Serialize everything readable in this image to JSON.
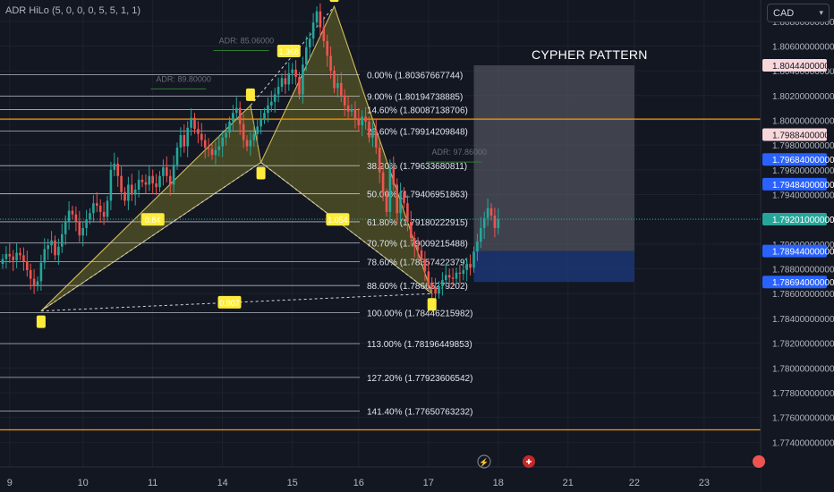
{
  "indicator": "ADR HiLo (5, 0, 0, 0, 5, 5, 1, 1)",
  "currency": "CAD",
  "pattern_title": "CYPHER PATTERN",
  "colors": {
    "background": "#131722",
    "grid": "#1e222d",
    "up": "#26a69a",
    "down": "#ef5350",
    "harmonic_fill": "#6b6b26",
    "harmonic_line": "#c8b45a",
    "fib_line": "#d1d4dc",
    "orange_line": "#ff9800",
    "price_highlight": "#2962ff",
    "price_current": "#26a69a",
    "target_box": "#5d5f6a",
    "stop_box": "#1c3470"
  },
  "chart_data": {
    "type": "candlestick",
    "x_ticks": [
      {
        "label": "9",
        "bar": 2
      },
      {
        "label": "10",
        "bar": 23
      },
      {
        "label": "11",
        "bar": 43
      },
      {
        "label": "14",
        "bar": 63
      },
      {
        "label": "15",
        "bar": 83
      },
      {
        "label": "16",
        "bar": 102
      },
      {
        "label": "17",
        "bar": 122
      },
      {
        "label": "18",
        "bar": 142
      },
      {
        "label": "21",
        "bar": 162
      },
      {
        "label": "22",
        "bar": 181
      },
      {
        "label": "23",
        "bar": 201
      }
    ],
    "y_range": [
      1.772,
      1.8095
    ],
    "y_ticks": [
      "1.80800000000",
      "1.80600000000",
      "1.80400000000",
      "1.80200000000",
      "1.80000000000",
      "1.79800000000",
      "1.79600000000",
      "1.79400000000",
      "1.79200000000",
      "1.79000000000",
      "1.78800000000",
      "1.78600000000",
      "1.78400000000",
      "1.78200000000",
      "1.78000000000",
      "1.77800000000",
      "1.77600000000",
      "1.77400000000"
    ],
    "price_labels": [
      {
        "text": "1.80444000000",
        "value": 1.80444,
        "style": "pink"
      },
      {
        "text": "1.79884000000",
        "value": 1.79884,
        "style": "pink"
      },
      {
        "text": "1.79684000000",
        "value": 1.79684,
        "style": "blue"
      },
      {
        "text": "1.79484000000",
        "value": 1.79484,
        "style": "blue"
      },
      {
        "text": "1.79201000000",
        "value": 1.79201,
        "style": "green"
      },
      {
        "text": "1.78944000000",
        "value": 1.78944,
        "style": "blue"
      },
      {
        "text": "1.78694000000",
        "value": 1.78694,
        "style": "blue"
      }
    ],
    "close_series": [
      1.7888,
      1.7892,
      1.789,
      1.7887,
      1.7893,
      1.7891,
      1.7886,
      1.7879,
      1.7872,
      1.7866,
      1.787,
      1.7885,
      1.7896,
      1.7899,
      1.7903,
      1.7891,
      1.7898,
      1.7908,
      1.7918,
      1.7927,
      1.7924,
      1.7918,
      1.7907,
      1.7913,
      1.792,
      1.7925,
      1.7933,
      1.7931,
      1.7926,
      1.7922,
      1.7935,
      1.796,
      1.7965,
      1.7955,
      1.7942,
      1.7935,
      1.7948,
      1.794,
      1.7944,
      1.7952,
      1.795,
      1.7948,
      1.7955,
      1.7949,
      1.7946,
      1.7955,
      1.7962,
      1.7955,
      1.7948,
      1.7964,
      1.7978,
      1.7988,
      1.7979,
      1.7994,
      1.8002,
      1.7993,
      1.7989,
      1.7984,
      1.7978,
      1.7977,
      1.7972,
      1.7976,
      1.7979,
      1.7986,
      1.799,
      1.7999,
      1.8006,
      1.801,
      1.7997,
      1.7984,
      1.7979,
      1.7984,
      1.7989,
      1.7995,
      1.8001,
      1.8006,
      1.8012,
      1.8015,
      1.8021,
      1.8027,
      1.8034,
      1.8029,
      1.8038,
      1.8041,
      1.8035,
      1.8021,
      1.8045,
      1.8059,
      1.8066,
      1.8079,
      1.8088,
      1.8075,
      1.8064,
      1.8052,
      1.804,
      1.8026,
      1.803,
      1.802,
      1.8012,
      1.8007,
      1.8009,
      1.8001,
      1.7996,
      1.8003,
      1.7999,
      1.7986,
      1.7992,
      1.7978,
      1.7958,
      1.7941,
      1.7926,
      1.7962,
      1.7948,
      1.7925,
      1.7942,
      1.7933,
      1.7918,
      1.7905,
      1.7898,
      1.7895,
      1.7888,
      1.7878,
      1.7868,
      1.7865,
      1.786,
      1.7866,
      1.7871,
      1.7875,
      1.7873,
      1.7872,
      1.7877,
      1.7876,
      1.7879,
      1.7884,
      1.7881,
      1.7894,
      1.7902,
      1.7913,
      1.7921,
      1.7929,
      1.7923,
      1.7913,
      1.792
    ],
    "fib_levels": [
      {
        "label": "0.00% (1.80367667744)",
        "value": 1.80367667744
      },
      {
        "label": "9.00% (1.80194738885)",
        "value": 1.80194738885
      },
      {
        "label": "14.60% (1.80087138706)",
        "value": 1.80087138706
      },
      {
        "label": "23.60% (1.79914209848)",
        "value": 1.79914209848
      },
      {
        "label": "38.20% (1.79633680811)",
        "value": 1.79633680811
      },
      {
        "label": "50.00% (1.79406951863)",
        "value": 1.79406951863
      },
      {
        "label": "61.80% (1.79180222915)",
        "value": 1.79180222915
      },
      {
        "label": "70.70% (1.79009215488)",
        "value": 1.79009215488
      },
      {
        "label": "78.60% (1.78857422379)",
        "value": 1.78857422379
      },
      {
        "label": "88.60% (1.78665279202)",
        "value": 1.78665279202
      },
      {
        "label": "100.00% (1.78446215982)",
        "value": 1.78446215982
      },
      {
        "label": "113.00% (1.78196449853)",
        "value": 1.78196449853
      },
      {
        "label": "127.20% (1.77923606542)",
        "value": 1.77923606542
      },
      {
        "label": "141.40% (1.77650763232)",
        "value": 1.77650763232
      }
    ],
    "orange_levels": [
      1.8001,
      1.775
    ],
    "adr_labels": [
      {
        "text": "ADR: 85.06000",
        "bar": 64,
        "value": 1.8065
      },
      {
        "text": "ADR: 89.80000",
        "bar": 46,
        "value": 1.8034
      },
      {
        "text": "ADR: 97.86000",
        "bar": 125,
        "value": 1.7975
      }
    ],
    "harmonic_points": [
      {
        "name": "X",
        "bar": 11,
        "value": 1.7846
      },
      {
        "name": "A",
        "bar": 71,
        "value": 1.8012
      },
      {
        "name": "B",
        "bar": 74,
        "value": 1.7966
      },
      {
        "name": "C",
        "bar": 95,
        "value": 1.8092
      },
      {
        "name": "D",
        "bar": 123,
        "value": 1.786
      }
    ],
    "point_labels": [
      "X",
      "A",
      "B",
      "C",
      "D"
    ],
    "ratio_labels": [
      {
        "text": "0.84",
        "bar": 43,
        "value": 1.792
      },
      {
        "text": "1.368",
        "bar": 82,
        "value": 1.8056
      },
      {
        "text": "0.907",
        "bar": 65,
        "value": 1.7853
      },
      {
        "text": "1.054",
        "bar": 96,
        "value": 1.792
      }
    ],
    "target_box": {
      "bar_start": 135,
      "bar_end": 181,
      "top": 1.80444,
      "bottom": 1.78944
    },
    "stop_box": {
      "bar_start": 135,
      "bar_end": 181,
      "top": 1.78944,
      "bottom": 1.78694
    }
  }
}
